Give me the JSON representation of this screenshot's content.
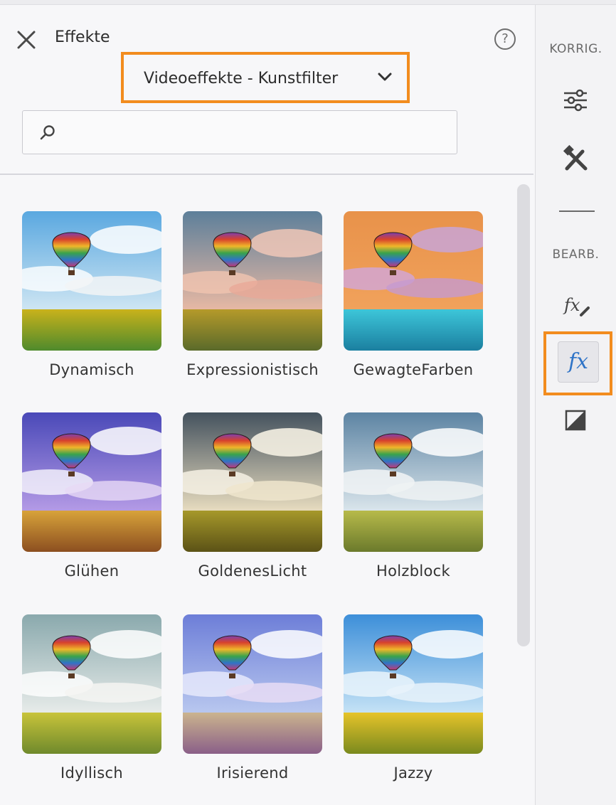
{
  "panel": {
    "title": "Effekte",
    "help_icon": "?",
    "close_icon": "close-icon",
    "dropdown": {
      "selected": "Videoeffekte - Kunstfilter"
    },
    "search": {
      "placeholder": "",
      "value": ""
    }
  },
  "effects": [
    {
      "label": "Dynamisch"
    },
    {
      "label": "Expressionistisch"
    },
    {
      "label": "GewagteFarben"
    },
    {
      "label": "Glühen"
    },
    {
      "label": "GoldenesLicht"
    },
    {
      "label": "Holzblock"
    },
    {
      "label": "Idyllisch"
    },
    {
      "label": "Irisierend"
    },
    {
      "label": "Jazzy"
    }
  ],
  "rail": {
    "section1": "KORRIG.",
    "section2": "BEARB.",
    "items": [
      {
        "icon": "sliders-icon"
      },
      {
        "icon": "tools-icon"
      },
      {
        "icon": "fx-edit-icon"
      },
      {
        "icon": "fx-icon",
        "active": true,
        "label": "fx"
      },
      {
        "icon": "contrast-icon"
      }
    ]
  },
  "colors": {
    "highlight": "#f28c1e",
    "fx_active": "#2f74c7"
  }
}
